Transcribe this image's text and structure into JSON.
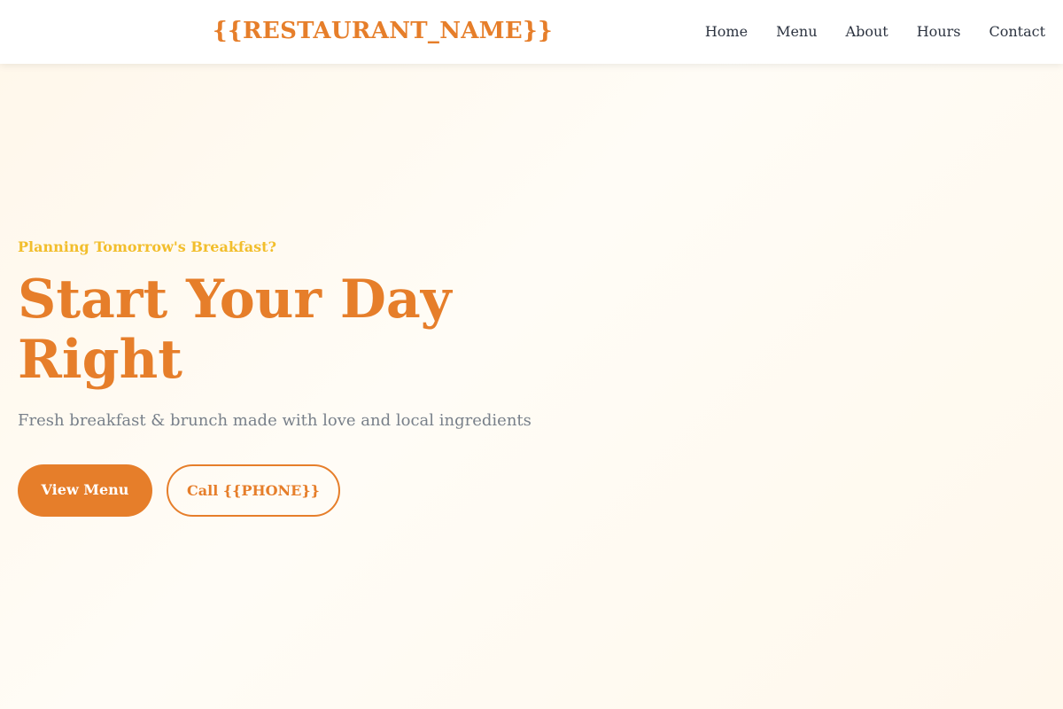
{
  "header": {
    "brand": "{{RESTAURANT_NAME}}",
    "nav": [
      "Home",
      "Menu",
      "About",
      "Hours",
      "Contact"
    ]
  },
  "hero": {
    "eyebrow": "Planning Tomorrow's Breakfast?",
    "headline_line1": "Start Your Day",
    "headline_line2": "Right",
    "subtitle": "Fresh breakfast & brunch made with love and local ingredients",
    "primary_button": "View Menu",
    "secondary_button": "Call {{PHONE}}"
  },
  "colors": {
    "accent": "#e67e2a",
    "eyebrow": "#f2be2c",
    "nav_text": "#2c3340",
    "subtitle": "#78808a"
  }
}
